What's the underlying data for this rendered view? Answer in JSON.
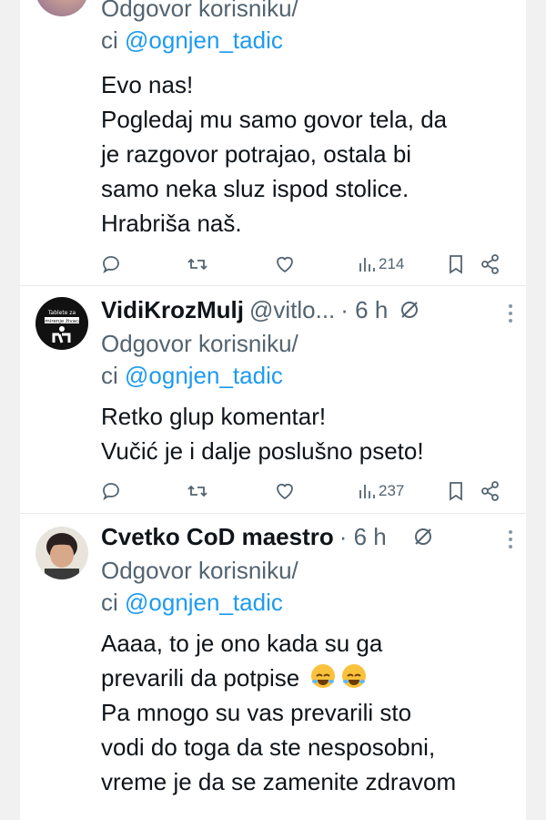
{
  "tweets": [
    {
      "name": "",
      "handle": "",
      "time": "",
      "reply_prefix": "Odgovor korisniku/",
      "reply_ci": "ci ",
      "reply_mention": "@ognjen_tadic",
      "lines": [
        "Evo nas!",
        "Pogledaj mu samo govor tela, da",
        "je razgovor potrajao, ostala bi",
        "samo neka sluz ispod stolice.",
        "Hrabriša naš."
      ],
      "views": "214"
    },
    {
      "name": "VidiKrozMulj",
      "handle": "@vitlo...",
      "time": "· 6 h",
      "avatar_text": "Tablete za smirenje živaca",
      "reply_prefix": "Odgovor korisniku/",
      "reply_ci": "ci ",
      "reply_mention": "@ognjen_tadic",
      "lines": [
        "Retko glup komentar!",
        "Vučić je i dalje poslušno pseto!"
      ],
      "views": "237"
    },
    {
      "name": "Cvetko CoD maestro",
      "handle": "",
      "time": "· 6 h",
      "reply_prefix": "Odgovor korisniku/",
      "reply_ci": "ci ",
      "reply_mention": "@ognjen_tadic",
      "lines": [
        "Aaaa, to je ono kada su ga",
        "prevarili da potpise",
        "Pa mnogo su vas prevarili sto",
        "vodi do toga da ste nesposobni,",
        "vreme je da se zamenite zdravom"
      ],
      "emoji": "rolling-on-floor-laughing x2",
      "views": ""
    }
  ],
  "icons": {
    "reply": "reply-icon",
    "retweet": "retweet-icon",
    "like": "like-icon",
    "views": "views-icon",
    "bookmark": "bookmark-icon",
    "share": "share-icon",
    "grok": "grok-icon",
    "more": "more-icon"
  },
  "colors": {
    "text": "#0f1419",
    "secondary": "#536471",
    "mention": "#1d9bf0",
    "divider": "#e7e9ea"
  }
}
